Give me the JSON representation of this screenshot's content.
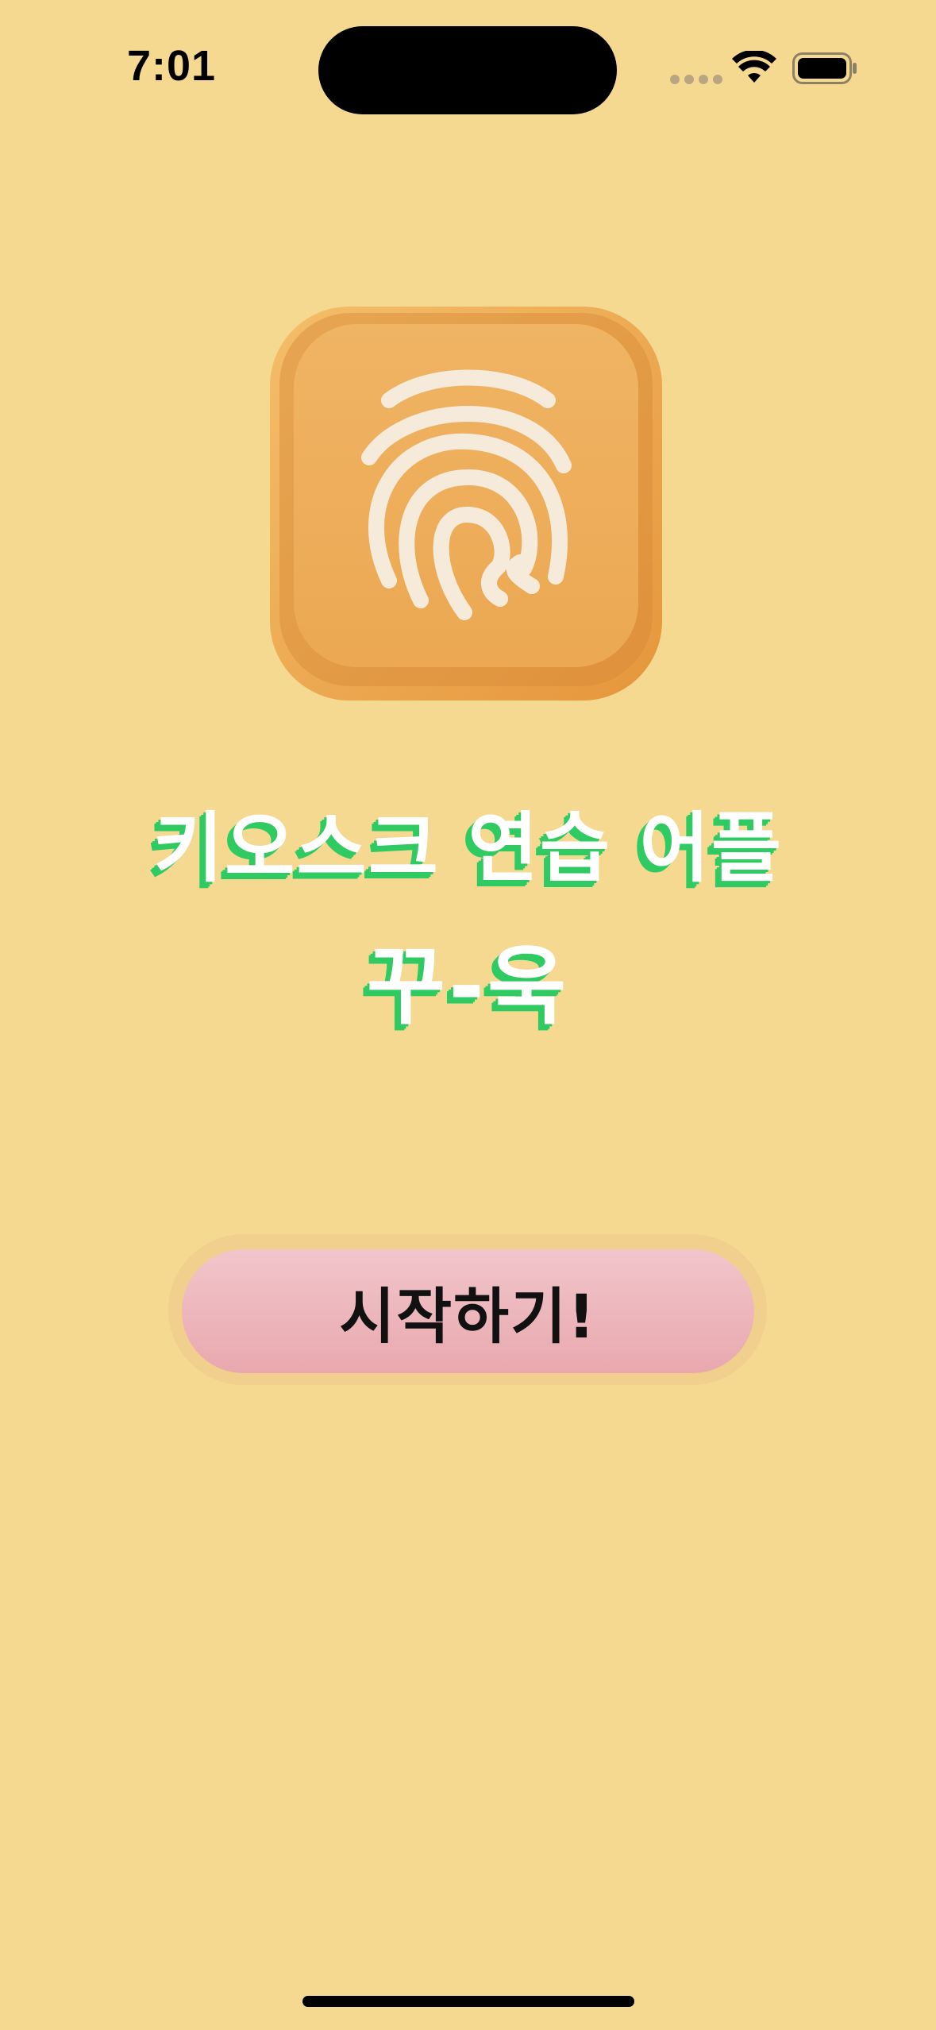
{
  "status_bar": {
    "time": "7:01",
    "wifi_icon": "wifi-icon",
    "battery_icon": "battery-icon"
  },
  "app_icon": {
    "name": "fingerprint-icon",
    "colors": {
      "tile": "#F0AE58",
      "tile_shadow": "#D98C3A",
      "fingerprint": "#F7EBDD"
    }
  },
  "title": {
    "line1": "키오스크 연습 어플",
    "line2": "꾸-욱"
  },
  "start_button": {
    "label": "시작하기!"
  },
  "colors": {
    "background": "#F5D991",
    "title_text": "#FFFFFF",
    "title_shadow": "#2FCB62",
    "button_top": "#F1C6CB",
    "button_bottom": "#E8A8AE"
  }
}
